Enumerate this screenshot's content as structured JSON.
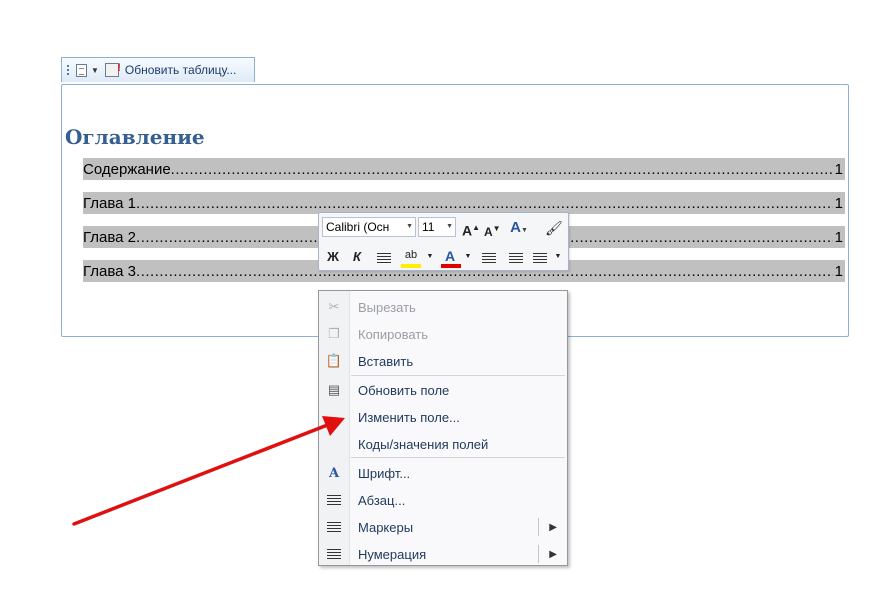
{
  "content_control": {
    "update_label": "Обновить таблицу..."
  },
  "toc": {
    "title": "Оглавление",
    "entries": [
      {
        "text": "Содержание",
        "page": "1"
      },
      {
        "text": "Глава 1",
        "page": "1"
      },
      {
        "text": "Глава 2",
        "page": "1"
      },
      {
        "text": "Глава 3",
        "page": "1"
      }
    ]
  },
  "mini_toolbar": {
    "font_name": "Calibri (Осн",
    "font_size": "11",
    "bold": "Ж",
    "italic": "К",
    "highlight_glyph": "ab",
    "font_color_glyph": "A",
    "grow_glyph": "A",
    "shrink_glyph": "A",
    "style_glyph": "A",
    "highlight_color": "#ffee00",
    "font_color": "#e00000"
  },
  "context_menu": {
    "items": [
      {
        "label": "Вырезать",
        "icon": "scissors-icon",
        "enabled": false
      },
      {
        "label": "Копировать",
        "icon": "copy-icon",
        "enabled": false
      },
      {
        "label": "Вставить",
        "icon": "paste-icon",
        "enabled": true
      },
      {
        "label": "Обновить поле",
        "icon": "update-field-icon",
        "enabled": true
      },
      {
        "label": "Изменить поле...",
        "icon": "",
        "enabled": true
      },
      {
        "label": "Коды/значения полей",
        "icon": "",
        "enabled": true
      },
      {
        "label": "Шрифт...",
        "icon": "font-icon",
        "enabled": true
      },
      {
        "label": "Абзац...",
        "icon": "paragraph-icon",
        "enabled": true
      },
      {
        "label": "Маркеры",
        "icon": "bullets-icon",
        "enabled": true,
        "submenu": true
      },
      {
        "label": "Нумерация",
        "icon": "numbering-icon",
        "enabled": true,
        "submenu": true
      }
    ]
  },
  "colors": {
    "heading": "#365f91",
    "field_shading": "#c0c0c0",
    "arrow": "#e01010"
  }
}
